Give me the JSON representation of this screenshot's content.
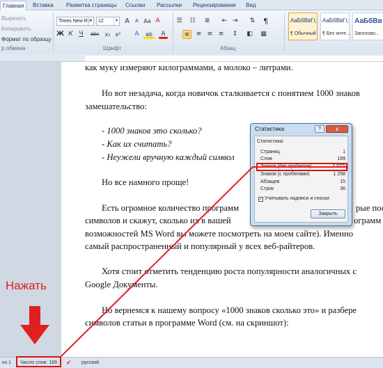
{
  "ribbon_tabs": [
    "Главная",
    "Вставка",
    "Разметка страницы",
    "Ссылки",
    "Рассылки",
    "Рецензирование",
    "Вид"
  ],
  "clipboard": {
    "cut": "Вырезать",
    "copy": "Копировать",
    "format": "Формат по образцу",
    "group": "р обмена"
  },
  "font": {
    "name": "Times New Rc",
    "size": "12",
    "group": "Шрифт",
    "bold": "Ж",
    "italic": "К",
    "underline": "Ч",
    "strike": "abc",
    "sub": "x₂",
    "sup": "x²",
    "grow": "A",
    "shrink": "A",
    "case": "Aa",
    "clear": "A",
    "text_effects": "A",
    "highlight": "ab",
    "color": "A"
  },
  "paragraph": {
    "group": "Абзац",
    "pilcrow": "¶"
  },
  "styles": [
    {
      "sample": "АаБбВвГг,",
      "name": "¶ Обычный"
    },
    {
      "sample": "АаБбВвГг,",
      "name": "¶ Без инте..."
    },
    {
      "sample": "АаБбВв",
      "name": "Заголово..."
    }
  ],
  "document": {
    "lines": [
      "как муку измеряют килограммами, а молоко – литрами.",
      "Но вот незадача, когда новичок сталкивается с понятием 1000 знаков",
      "замешательство:",
      "- 1000 знаков это сколько?",
      "- Как их считать?",
      "- Неужели вручную каждый символ",
      "Но все намного проще!",
      "Есть огромное количество программ",
      "символов и скажут, сколько их в вашей",
      "возможностей MS Word вы можете посмотреть на моем сайте). Именно",
      "самый распространенный и популярный у всех веб-райтеров.",
      "Хотя стоит отметить тенденцию роста популярности аналогичных с",
      "Google Документы.",
      "Но вернемся к нашему вопросу «1000 знаков сколько это» и разбере",
      "символов статьи в программе Word (см. на скриншот):"
    ],
    "right_frag_1": "рые посч",
    "right_frag_2": "ограмм"
  },
  "dialog": {
    "title": "Статистика",
    "help": "?",
    "close": "x",
    "header": "Статистика:",
    "rows": [
      {
        "label": "Страниц",
        "value": "1"
      },
      {
        "label": "Слов",
        "value": "189"
      },
      {
        "label": "Знаков (без пробелов)",
        "value": "1 072"
      },
      {
        "label": "Знаков (с пробелами)",
        "value": "1 258"
      },
      {
        "label": "Абзацев",
        "value": "15"
      },
      {
        "label": "Строк",
        "value": "36"
      }
    ],
    "checkbox": "Учитывать надписи и сноски",
    "close_button": "Закрыть"
  },
  "annotation": {
    "label": "Нажать",
    "color": "#e02020"
  },
  "status": {
    "page": "из 1",
    "words": "Число слов: 189",
    "language": "русский"
  }
}
